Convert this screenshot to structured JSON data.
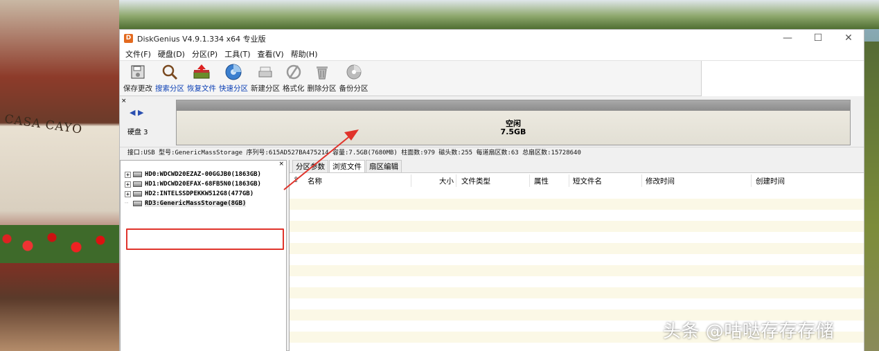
{
  "background": {
    "sign_text": "CASA CAYO"
  },
  "window": {
    "title": "DiskGenius V4.9.1.334 x64 专业版",
    "controls": {
      "minimize": "—",
      "maximize": "☐",
      "close": "✕"
    }
  },
  "menu": [
    "文件(F)",
    "硬盘(D)",
    "分区(P)",
    "工具(T)",
    "查看(V)",
    "帮助(H)"
  ],
  "toolbar": [
    {
      "label": "保存更改",
      "icon": "save-icon",
      "blue": false
    },
    {
      "label": "搜索分区",
      "icon": "search-icon",
      "blue": true
    },
    {
      "label": "恢复文件",
      "icon": "recover-icon",
      "blue": true
    },
    {
      "label": "快速分区",
      "icon": "quick-partition-icon",
      "blue": true
    },
    {
      "label": "新建分区",
      "icon": "new-partition-icon",
      "blue": false
    },
    {
      "label": "格式化",
      "icon": "format-icon",
      "blue": false
    },
    {
      "label": "删除分区",
      "icon": "delete-icon",
      "blue": false
    },
    {
      "label": "备份分区",
      "icon": "backup-icon",
      "blue": false
    }
  ],
  "disk_area": {
    "close": "×",
    "label": "硬盘 3",
    "free_label": "空闲",
    "free_size": "7.5GB"
  },
  "disk_info": "接口:USB  型号:GenericMassStorage  序列号:615AD527BA475214  容量:7.5GB(7680MB)  柱面数:979  磁头数:255  每道扇区数:63  总扇区数:15728640",
  "tree": {
    "close": "×",
    "items": [
      {
        "label": "HD0:WDCWD20EZAZ-00GGJB0(1863GB)",
        "expand": "+"
      },
      {
        "label": "HD1:WDCWD20EFAX-68FB5N0(1863GB)",
        "expand": "+"
      },
      {
        "label": "HD2:INTELSSDPEKKW512G8(477GB)",
        "expand": "+"
      },
      {
        "label": "RD3:GenericMassStorage(8GB)",
        "expand": ""
      }
    ]
  },
  "tabs": [
    "分区参数",
    "浏览文件",
    "扇区编辑"
  ],
  "active_tab": "浏览文件",
  "columns": [
    "名称",
    "大小",
    "文件类型",
    "属性",
    "短文件名",
    "修改时间",
    "创建时间"
  ],
  "watermark": "头条 @咕哒存存存储"
}
